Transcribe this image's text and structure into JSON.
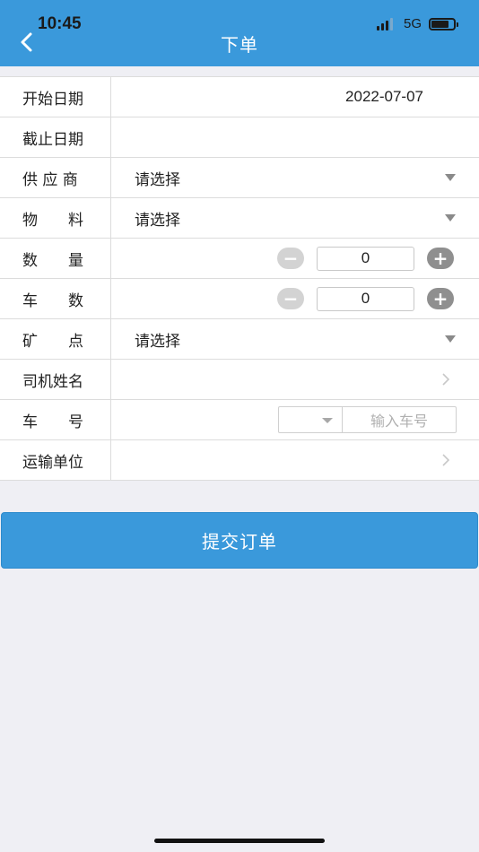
{
  "status_bar": {
    "time": "10:45",
    "network": "5G"
  },
  "header": {
    "title": "下单"
  },
  "form": {
    "start_date": {
      "label": "开始日期",
      "value": "2022-07-07"
    },
    "end_date": {
      "label": "截止日期",
      "value": ""
    },
    "supplier": {
      "label": "供 应 商",
      "value": "请选择"
    },
    "material": {
      "label": "物　　料",
      "value": "请选择"
    },
    "quantity": {
      "label": "数　　量",
      "value": "0"
    },
    "vehicle_count": {
      "label": "车　　数",
      "value": "0"
    },
    "mine_point": {
      "label": "矿　　点",
      "value": "请选择"
    },
    "driver_name": {
      "label": "司机姓名"
    },
    "plate_number": {
      "label": "车　　号",
      "placeholder": "输入车号"
    },
    "transport_unit": {
      "label": "运输单位"
    }
  },
  "submit": {
    "label": "提交订单"
  },
  "colors": {
    "accent": "#3a99db",
    "background": "#efeff4"
  }
}
